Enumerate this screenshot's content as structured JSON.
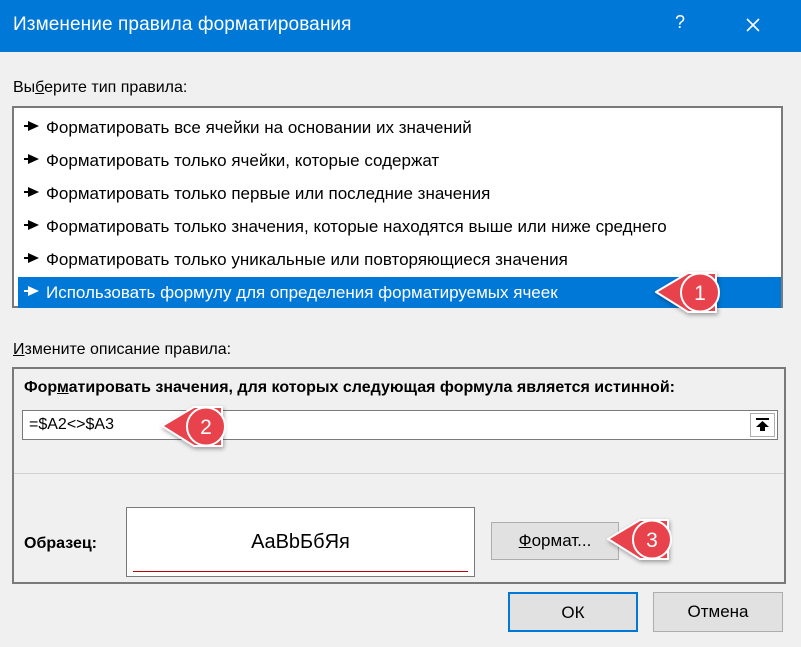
{
  "dialog": {
    "title": "Изменение правила форматирования",
    "help_glyph": "?"
  },
  "rule_type": {
    "label": "Выберите тип правила:",
    "label_parts": [
      "Вы",
      "б",
      "ерите тип правила:"
    ],
    "items": [
      "Форматировать все ячейки на основании их значений",
      "Форматировать только ячейки, которые содержат",
      "Форматировать только первые или последние значения",
      "Форматировать только значения, которые находятся выше или ниже среднего",
      "Форматировать только уникальные или повторяющиеся значения",
      "Использовать формулу для определения форматируемых ячеек"
    ],
    "selected_index": 5
  },
  "description": {
    "label": "Измените описание правила:",
    "label_parts": [
      "",
      "И",
      "змените описание правила:"
    ],
    "formula_label": "Форматировать значения, для которых следующая формула является истинной:",
    "formula_label_parts": [
      "Фор",
      "м",
      "атировать значения, для которых следующая формула является истинной:"
    ],
    "formula_value": "=$A2<>$A3",
    "sample_label": "Образец:",
    "sample_text": "AaBbБбЯя",
    "format_button": {
      "underlined": "Ф",
      "rest": "ормат..."
    }
  },
  "buttons": {
    "ok": "ОК",
    "cancel": "Отмена"
  },
  "callouts": [
    "1",
    "2",
    "3"
  ],
  "colors": {
    "accent": "#0078d7",
    "callout": "#e8424c",
    "sample_underline": "#c00000"
  }
}
